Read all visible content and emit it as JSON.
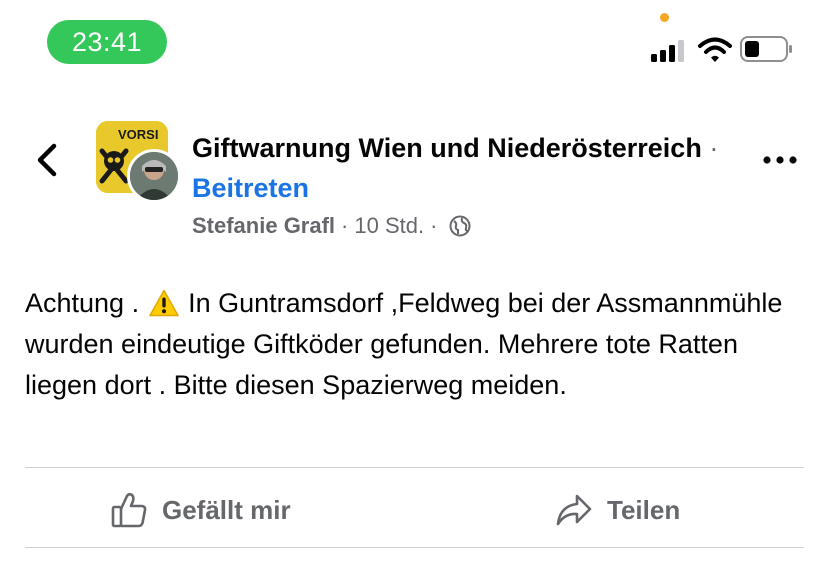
{
  "status_bar": {
    "time": "23:41"
  },
  "post": {
    "group_name": "Giftwarnung Wien und Niederösterreich",
    "separator": " · ",
    "join_label": "Beitreten",
    "author": "Stefanie Grafl",
    "dot": "·",
    "time_ago": "10 Std.",
    "privacy_icon": "globe-icon",
    "body_part1": "Achtung . ",
    "body_part2": " In Guntramsdorf ,Feldweg bei der Assmannmühle wurden eindeutige Giftköder gefunden. Mehrere tote Ratten liegen dort . Bitte diesen Spazierweg meiden.",
    "group_avatar_text": "VORSI"
  },
  "actions": {
    "like_label": "Gefällt mir",
    "share_label": "Teilen"
  },
  "colors": {
    "status_time_bg": "#34c759",
    "link_blue": "#1b74e4",
    "secondary_text": "#65676b",
    "divider": "#ced0d4"
  }
}
